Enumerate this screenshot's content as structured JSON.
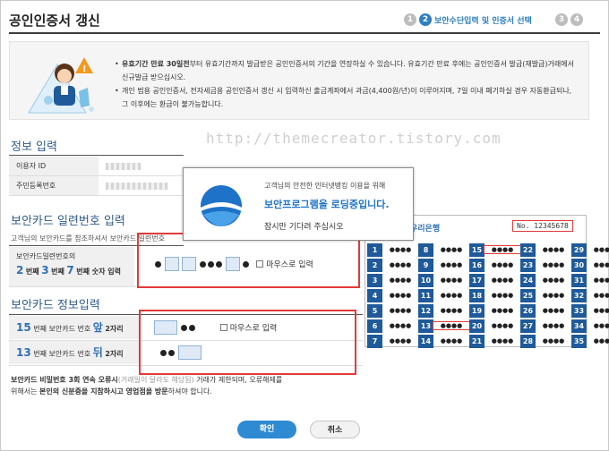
{
  "header": {
    "title": "공인인증서 갱신",
    "steps": [
      "1",
      "2",
      "3",
      "4"
    ],
    "active_step_label": "보안수단입력 및 인증서 선택"
  },
  "notice": {
    "items": [
      {
        "pre": "유효기간 만료 30일전",
        "post": "부터 유효기간까지 발급받은 공인인증서의 기간을 연장하실 수 있습니다. 유효기간 만료 후에는 공인인증서 발급(재발급)거래에서 신규발급 받으십시오."
      },
      {
        "pre": "",
        "post": "개인 범용 공인인증서, 전자세금용 공인인증서 갱신 시 입력하신 출금계좌에서 과금(4,400원/년)이 이루어지며, 7일 이내 폐기하실 경우 자동환급되나, 그 이후에는 환급이 불가능합니다."
      }
    ]
  },
  "watermark": "http://themecreator.tistory.com",
  "info": {
    "title": "정보 입력",
    "rows": [
      {
        "label": "이용자 ID"
      },
      {
        "label": "주민등록번호"
      }
    ]
  },
  "serial": {
    "title": "보안카드 일련번호 입력",
    "hint": "고객님의 보안카드를 참조하셔서 보안카드 일련번호",
    "row_label_top": "보안카드일련번호의",
    "n1": "2",
    "t1": "번째",
    "n2": "3",
    "t2": "번째",
    "n3": "7",
    "t3": "번째 숫자 입력",
    "mouse_label": "마우스로 입력"
  },
  "cardinfo": {
    "title": "보안카드 정보입력",
    "row1": {
      "num": "15",
      "mid": "번째 보안카드 번호",
      "pos": "앞",
      "tail": "2자리"
    },
    "row2": {
      "num": "13",
      "mid": "번째 보안카드 번호",
      "pos": "뒤",
      "tail": "2자리"
    },
    "mouse_label": "마우스로 입력"
  },
  "warning": {
    "line1_pre": "보안카드 비밀번호 3회 연속 오류시",
    "line1_mid": "(거래일이 달라도 해당됨)",
    "line1_post": " 거래가 제한되며, 오류해제를",
    "line2_pre": "위해서는 ",
    "line2_b1": "본인의 신분증을 지참하시고 영업점을 방문",
    "line2_post": "하셔야 합니다."
  },
  "popup": {
    "line1": "고객님의 안전한 인터넷뱅킹 이용을 위해",
    "line2": "보안프로그램을 로딩중입니다.",
    "line3": "잠시만 기다려 주십시오"
  },
  "card": {
    "bank": "우리은행",
    "serial_label": "No. 12345678",
    "dots": "●●●●",
    "rows": [
      [
        "1",
        "8",
        "15",
        "22",
        "29"
      ],
      [
        "2",
        "9",
        "16",
        "23",
        "30"
      ],
      [
        "3",
        "10",
        "17",
        "24",
        "31"
      ],
      [
        "4",
        "11",
        "18",
        "25",
        "32"
      ],
      [
        "5",
        "12",
        "19",
        "26",
        "33"
      ],
      [
        "6",
        "13",
        "20",
        "27",
        "34"
      ],
      [
        "7",
        "14",
        "21",
        "28",
        "35"
      ]
    ]
  },
  "buttons": {
    "ok": "확인",
    "cancel": "취소"
  },
  "colors": {
    "accent": "#2e7fc1",
    "highlight": "#e23a3a",
    "card_number_bg": "#1f5a9a"
  }
}
